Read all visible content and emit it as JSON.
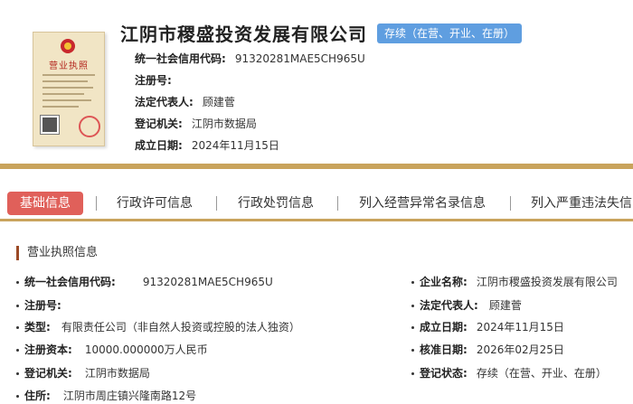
{
  "header": {
    "license_image_title": "营业执照",
    "company_name": "江阴市稷盛投资发展有限公司",
    "status_badge": "存续（在营、开业、在册）",
    "info": [
      {
        "label": "统一社会信用代码:",
        "value": "91320281MAE5CH965U"
      },
      {
        "label": "注册号:",
        "value": ""
      },
      {
        "label": "法定代表人:",
        "value": "顾建菅"
      },
      {
        "label": "登记机关:",
        "value": "江阴市数据局"
      },
      {
        "label": "成立日期:",
        "value": "2024年11月15日"
      }
    ]
  },
  "tabs": [
    {
      "label": "基础信息"
    },
    {
      "label": "行政许可信息"
    },
    {
      "label": "行政处罚信息"
    },
    {
      "label": "列入经营异常名录信息"
    },
    {
      "label": "列入严重违法失信"
    }
  ],
  "section": {
    "title": "营业执照信息"
  },
  "details_left": [
    {
      "label": "统一社会信用代码:",
      "value": "91320281MAE5CH965U"
    },
    {
      "label": "注册号:",
      "value": ""
    },
    {
      "label": "类型:",
      "value": "有限责任公司（非自然人投资或控股的法人独资）"
    },
    {
      "label": "注册资本:",
      "value": "10000.000000万人民币"
    },
    {
      "label": "登记机关:",
      "value": "江阴市数据局"
    },
    {
      "label": "住所:",
      "value": "江阴市周庄镇兴隆南路12号"
    }
  ],
  "details_right": [
    {
      "label": "企业名称:",
      "value": "江阴市稷盛投资发展有限公司"
    },
    {
      "label": "法定代表人:",
      "value": "顾建菅"
    },
    {
      "label": "成立日期:",
      "value": "2024年11月15日"
    },
    {
      "label": "核准日期:",
      "value": "2026年02月25日"
    },
    {
      "label": "登记状态:",
      "value": "存续（在营、开业、在册）"
    }
  ],
  "colors": {
    "accent_gold": "#c9a35c",
    "active_tab": "#e0605a",
    "status_badge": "#5f9ee0",
    "section_marker": "#9b4a26"
  }
}
